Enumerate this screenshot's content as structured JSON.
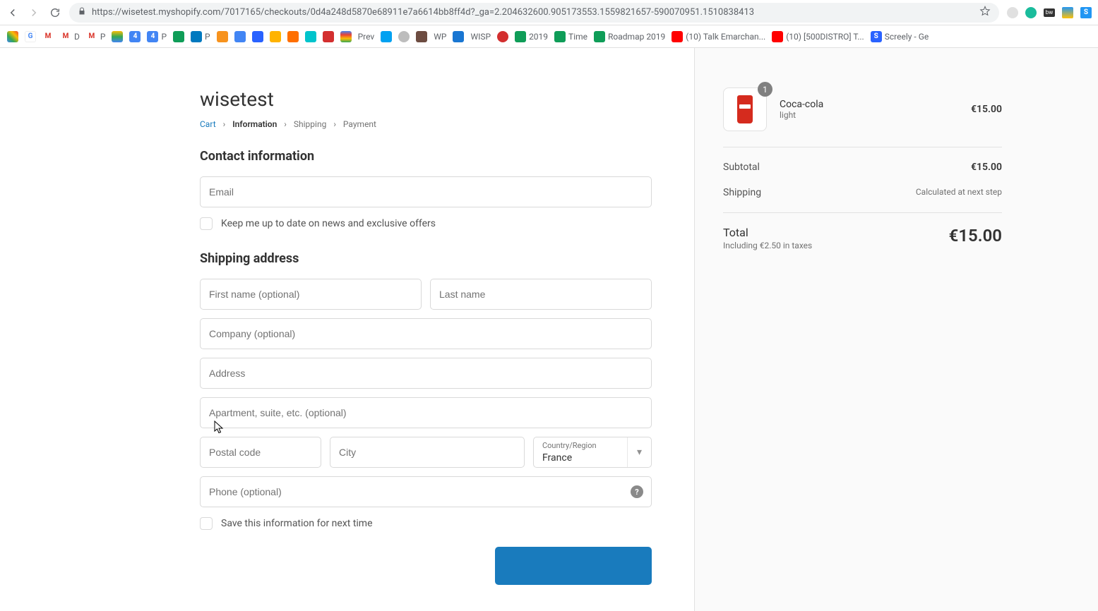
{
  "browser": {
    "url": "https://wisetest.myshopify.com/7017165/checkouts/0d4a248d5870e68911e7a6614bb8ff4d?_ga=2.204632600.905173553.1559821657-590070951.1510838413",
    "bookmarks": [
      {
        "label": "",
        "bg": "linear-gradient(45deg,#4285f4,#34a853,#fbbc05,#ea4335)"
      },
      {
        "label": "G",
        "bg": "#fff",
        "fg": "#4285f4"
      },
      {
        "label": "M",
        "bg": "#fff",
        "fg": "#d93025"
      },
      {
        "label": "M D",
        "bg": "#fff",
        "fg": "#d93025"
      },
      {
        "label": "M P",
        "bg": "#fff",
        "fg": "#d93025"
      },
      {
        "label": "",
        "bg": "linear-gradient(#34a853,#fbbc05,#4285f4)"
      },
      {
        "label": "4",
        "bg": "#4285f4"
      },
      {
        "label": "4 P",
        "bg": "#4285f4"
      },
      {
        "label": "",
        "bg": "#0f9d58"
      },
      {
        "label": "P",
        "bg": "#0079bf"
      },
      {
        "label": "",
        "bg": "#f7931e"
      },
      {
        "label": "",
        "bg": "#4285f4"
      },
      {
        "label": "",
        "bg": "#2962ff"
      },
      {
        "label": "",
        "bg": "#ffb300"
      },
      {
        "label": "",
        "bg": "#ff6f00"
      },
      {
        "label": "",
        "bg": "#00c4cc"
      },
      {
        "label": "",
        "bg": "#d32f2f"
      },
      {
        "label": "",
        "bg": "linear-gradient(#4285f4,#ea4335,#fbbc05,#34a853)"
      },
      {
        "label": "Prev",
        "bg": "#fff",
        "fg": "#666"
      },
      {
        "label": "",
        "bg": "#00a1f1"
      },
      {
        "label": "",
        "bg": "#bdbdbd"
      },
      {
        "label": "",
        "bg": "#6d4c41"
      },
      {
        "label": "WP",
        "bg": "#fff",
        "fg": "#666"
      },
      {
        "label": "",
        "bg": "#1976d2"
      },
      {
        "label": "WISP",
        "bg": "#fff",
        "fg": "#666"
      },
      {
        "label": "",
        "bg": "#d32f2f"
      },
      {
        "label": "2019",
        "bg": "#0f9d58"
      },
      {
        "label": "Time",
        "bg": "#0f9d58"
      },
      {
        "label": "Roadmap 2019",
        "bg": "#0f9d58"
      },
      {
        "label": "(10) Talk Emarchan...",
        "bg": "#ff0000"
      },
      {
        "label": "(10) [500DISTRO] T...",
        "bg": "#ff0000"
      },
      {
        "label": "Screely - Ge",
        "bg": "#2962ff"
      }
    ]
  },
  "store": {
    "name": "wisetest"
  },
  "breadcrumb": {
    "cart": "Cart",
    "information": "Information",
    "shipping": "Shipping",
    "payment": "Payment"
  },
  "contact": {
    "title": "Contact information",
    "email_placeholder": "Email",
    "newsletter": "Keep me up to date on news and exclusive offers"
  },
  "shipping": {
    "title": "Shipping address",
    "first_name": "First name (optional)",
    "last_name": "Last name",
    "company": "Company (optional)",
    "address": "Address",
    "apartment": "Apartment, suite, etc. (optional)",
    "postal": "Postal code",
    "city": "City",
    "country_label": "Country/Region",
    "country_value": "France",
    "phone": "Phone (optional)",
    "save": "Save this information for next time"
  },
  "order": {
    "product": {
      "name": "Coca-cola",
      "variant": "light",
      "qty": "1",
      "price": "€15.00"
    },
    "subtotal_label": "Subtotal",
    "subtotal_value": "€15.00",
    "shipping_label": "Shipping",
    "shipping_value": "Calculated at next step",
    "total_label": "Total",
    "total_sub": "Including €2.50 in taxes",
    "total_value": "€15.00"
  }
}
